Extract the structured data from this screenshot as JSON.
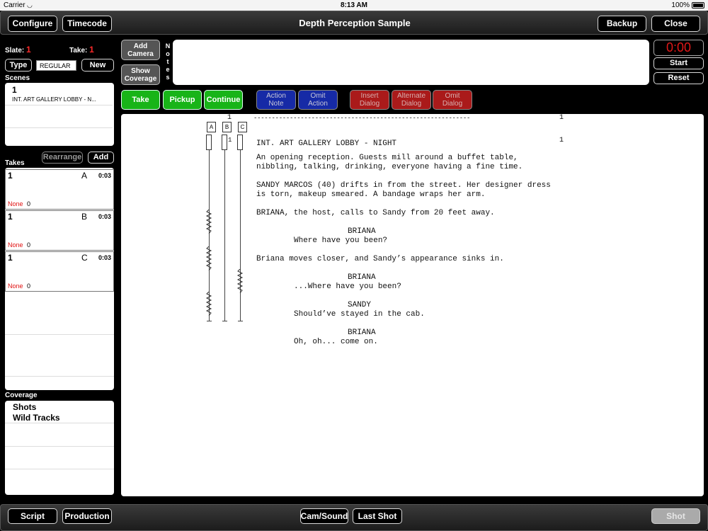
{
  "status": {
    "carrier": "Carrier",
    "time": "8:13 AM",
    "battery": "100%"
  },
  "header": {
    "title": "Depth Perception Sample",
    "configure": "Configure",
    "timecode": "Timecode",
    "backup": "Backup",
    "close": "Close"
  },
  "slate": {
    "slate_label": "Slate:",
    "slate_value": "1",
    "take_label": "Take:",
    "take_value": "1",
    "type_button": "Type",
    "type_value": "REGULAR",
    "new_button": "New"
  },
  "actions": {
    "add_camera": "Add\nCamera",
    "show_coverage": "Show\nCoverage",
    "take": "Take",
    "pickup": "Pickup",
    "continue": "Continue",
    "action_note": "Action\nNote",
    "omit_action": "Omit\nAction",
    "insert_dialog": "Insert\nDialog",
    "alternate_dialog": "Alternate\nDialog",
    "omit_dialog": "Omit\nDialog"
  },
  "notes": {
    "label": "Notes"
  },
  "timer": {
    "value": "0:00",
    "start": "Start",
    "reset": "Reset"
  },
  "scenes": {
    "label": "Scenes",
    "items": [
      {
        "number": "1",
        "name": "INT. ART GALLERY LOBBY - N..."
      }
    ]
  },
  "takes": {
    "label": "Takes",
    "rearrange": "Rearrange",
    "add": "Add",
    "items": [
      {
        "number": "1",
        "camera": "A",
        "duration": "0:03",
        "circle": "None",
        "count": "0"
      },
      {
        "number": "1",
        "camera": "B",
        "duration": "0:03",
        "circle": "None",
        "count": "0"
      },
      {
        "number": "1",
        "camera": "C",
        "duration": "0:03",
        "circle": "None",
        "count": "0"
      }
    ]
  },
  "coverage": {
    "label": "Coverage",
    "items": [
      "Shots",
      "Wild Tracks"
    ]
  },
  "script": {
    "cameras": [
      "A",
      "B",
      "C"
    ],
    "page_marker": "1",
    "rule": "------------------------------------------------------------",
    "rule_num": "1",
    "b_num": "1",
    "scene_num": "1",
    "heading": "INT. ART GALLERY LOBBY - NIGHT",
    "lines": [
      {
        "indent": 0,
        "text": "An opening reception. Guests mill around a buffet table,"
      },
      {
        "indent": 0,
        "text": "nibbling, talking, drinking, everyone having a fine time."
      },
      {
        "indent": 0,
        "text": ""
      },
      {
        "indent": 0,
        "text": "SANDY MARCOS (40) drifts in from the street. Her designer dress"
      },
      {
        "indent": 0,
        "text": "is torn, makeup smeared. A bandage wraps her arm."
      },
      {
        "indent": 0,
        "text": ""
      },
      {
        "indent": 0,
        "text": "BRIANA, the host, calls to Sandy from 20 feet away."
      },
      {
        "indent": 0,
        "text": ""
      },
      {
        "indent": 2,
        "text": "BRIANA"
      },
      {
        "indent": 1,
        "text": "Where have you been?"
      },
      {
        "indent": 0,
        "text": ""
      },
      {
        "indent": 0,
        "text": "Briana moves closer, and Sandy’s appearance sinks in."
      },
      {
        "indent": 0,
        "text": ""
      },
      {
        "indent": 2,
        "text": "BRIANA"
      },
      {
        "indent": 1,
        "text": "...Where have you been?"
      },
      {
        "indent": 0,
        "text": ""
      },
      {
        "indent": 2,
        "text": "SANDY"
      },
      {
        "indent": 1,
        "text": "Should’ve stayed in the cab."
      },
      {
        "indent": 0,
        "text": ""
      },
      {
        "indent": 2,
        "text": "BRIANA"
      },
      {
        "indent": 1,
        "text": "Oh, oh... come on."
      }
    ]
  },
  "footer": {
    "script": "Script",
    "production": "Production",
    "cam_sound": "Cam/Sound",
    "last_shot": "Last Shot",
    "shot": "Shot"
  }
}
